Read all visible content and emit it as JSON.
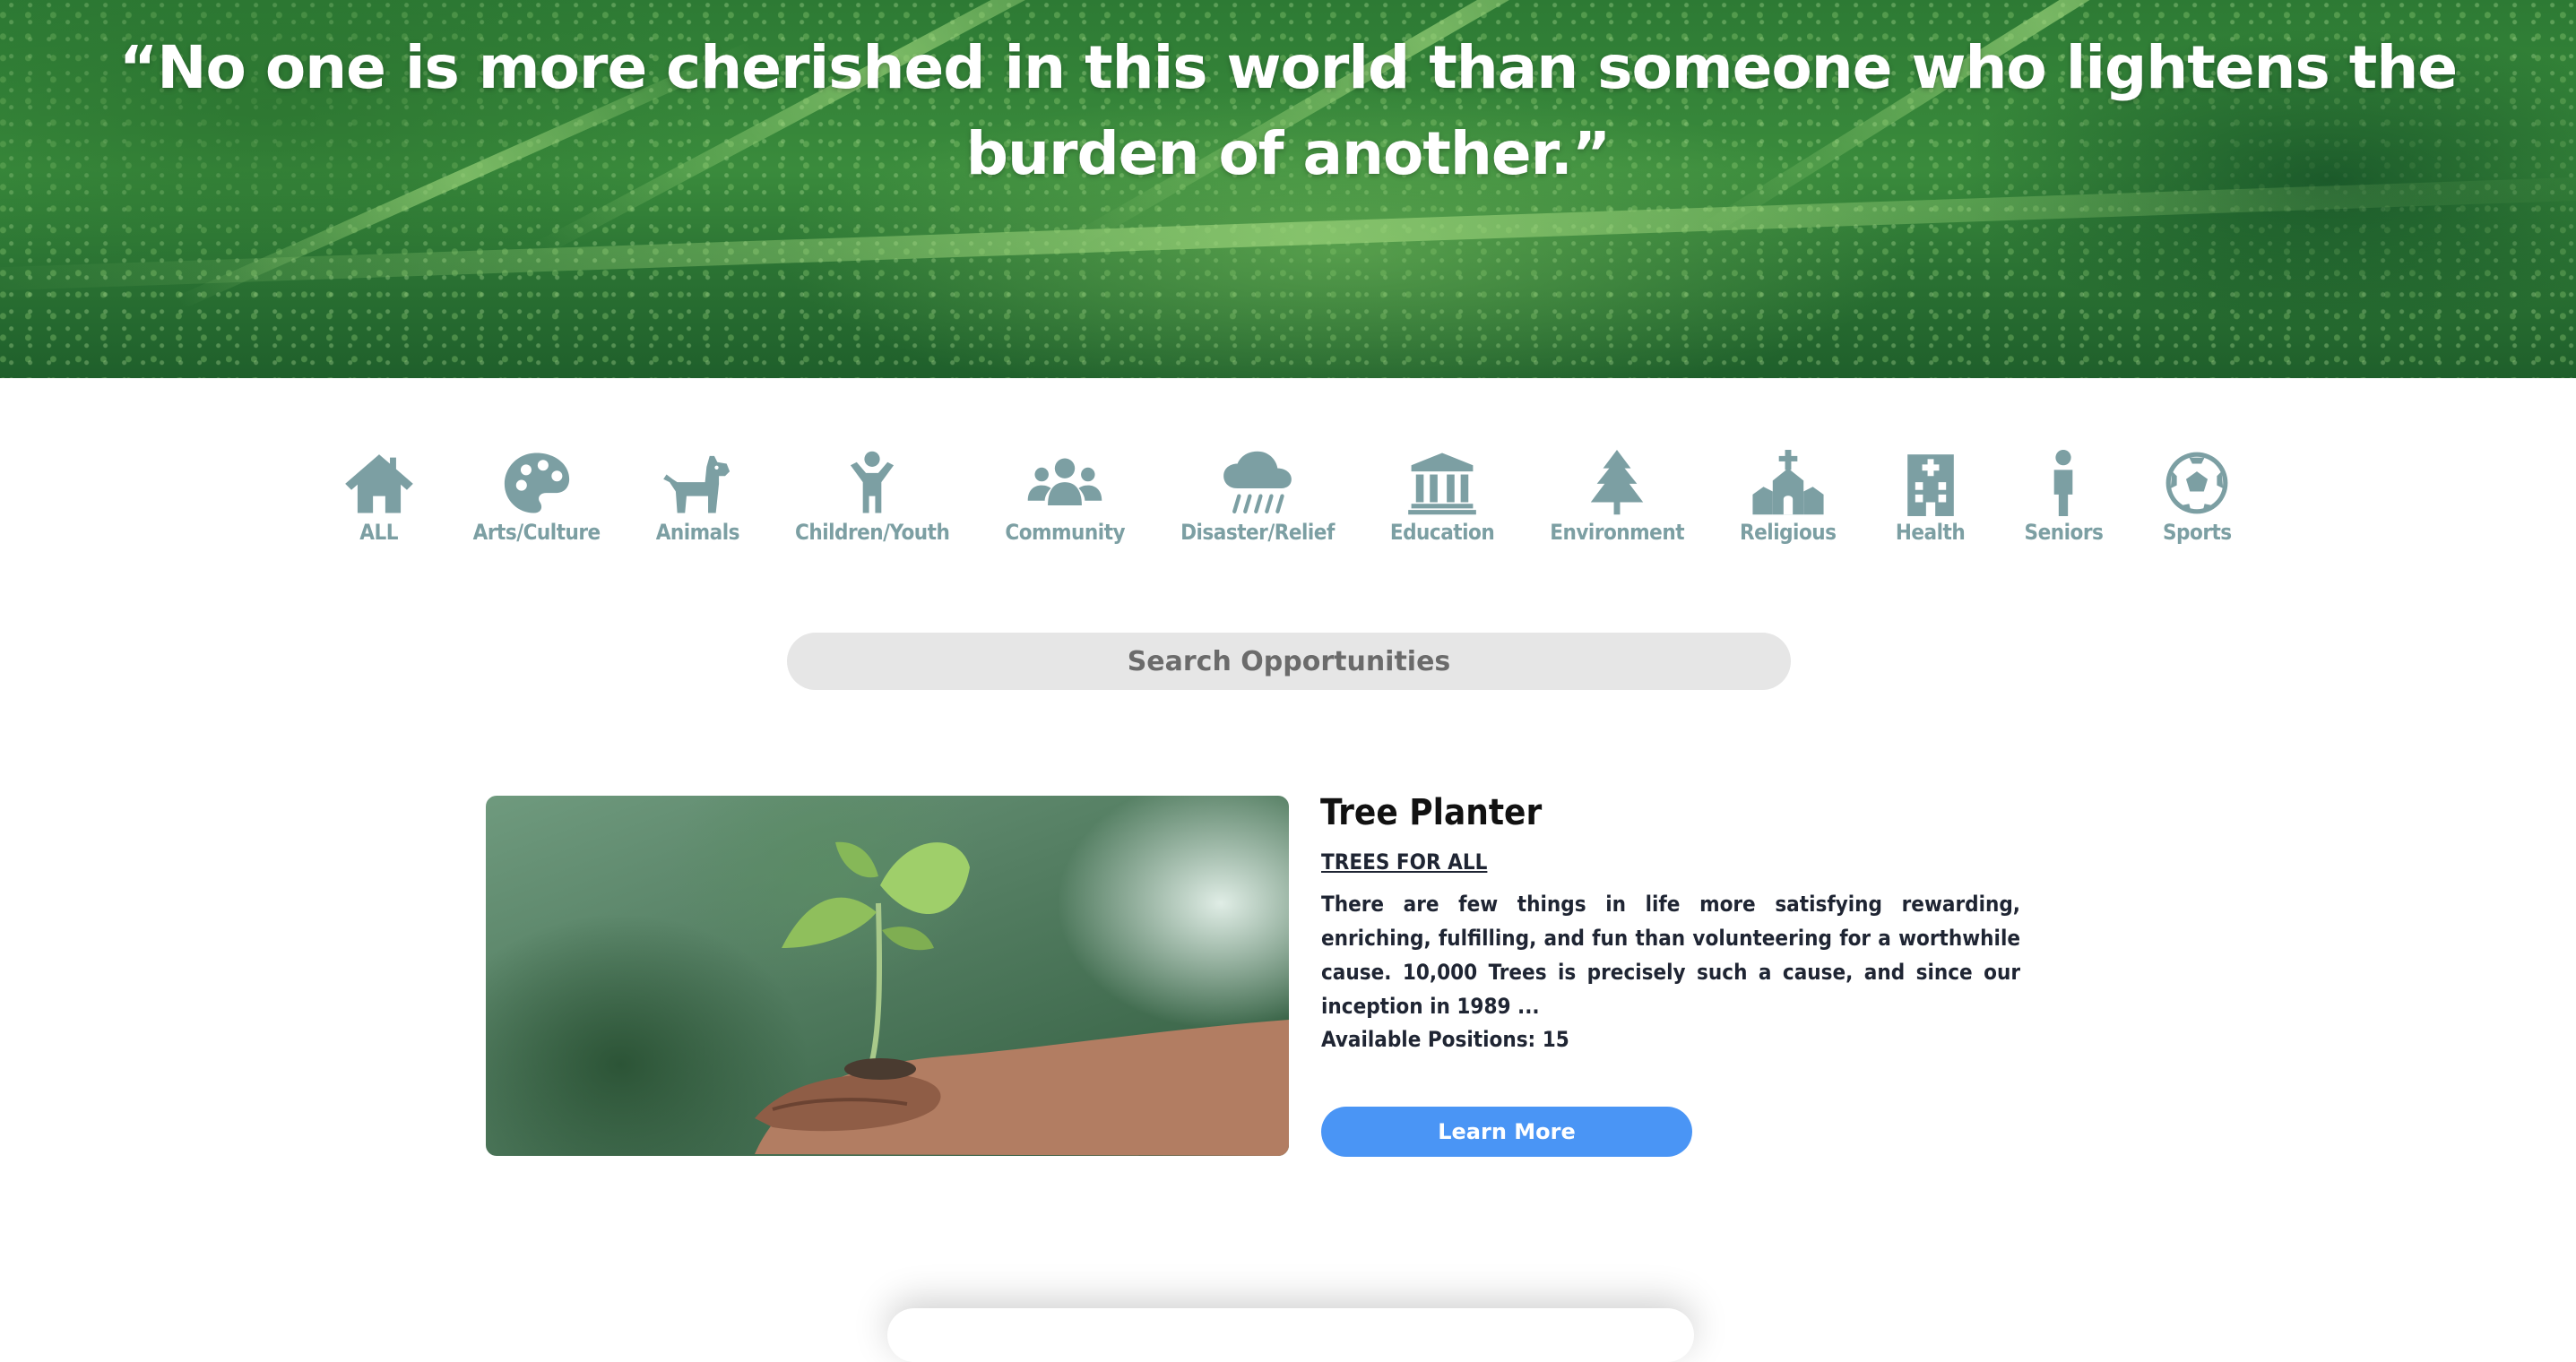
{
  "hero": {
    "quote": "“No one is more cherished in this world than someone who lightens the burden of another.”"
  },
  "categories": [
    {
      "label": "ALL",
      "icon": "home-icon"
    },
    {
      "label": "Arts/Culture",
      "icon": "palette-icon"
    },
    {
      "label": "Animals",
      "icon": "dog-icon"
    },
    {
      "label": "Children/Youth",
      "icon": "child-icon"
    },
    {
      "label": "Community",
      "icon": "users-icon"
    },
    {
      "label": "Disaster/Relief",
      "icon": "cloud-rain-icon"
    },
    {
      "label": "Education",
      "icon": "landmark-icon"
    },
    {
      "label": "Environment",
      "icon": "tree-icon"
    },
    {
      "label": "Religious",
      "icon": "church-icon"
    },
    {
      "label": "Health",
      "icon": "hospital-icon"
    },
    {
      "label": "Seniors",
      "icon": "person-icon"
    },
    {
      "label": "Sports",
      "icon": "soccer-ball-icon"
    }
  ],
  "search": {
    "placeholder": "Search Opportunities"
  },
  "opportunity": {
    "title": "Tree Planter",
    "organization": "TREES FOR ALL",
    "description": "There are few things in life more satisfying rewarding, enriching, fulfilling, and fun than volunteering for a worthwhile cause. 10,000 Trees is precisely such a cause, and since our inception in 1989 ...",
    "positions": "Available Positions: 15",
    "button_label": "Learn More"
  },
  "colors": {
    "icon": "#7c9fa3",
    "button": "#4a95f5",
    "search_bg": "#e6e6e6"
  }
}
